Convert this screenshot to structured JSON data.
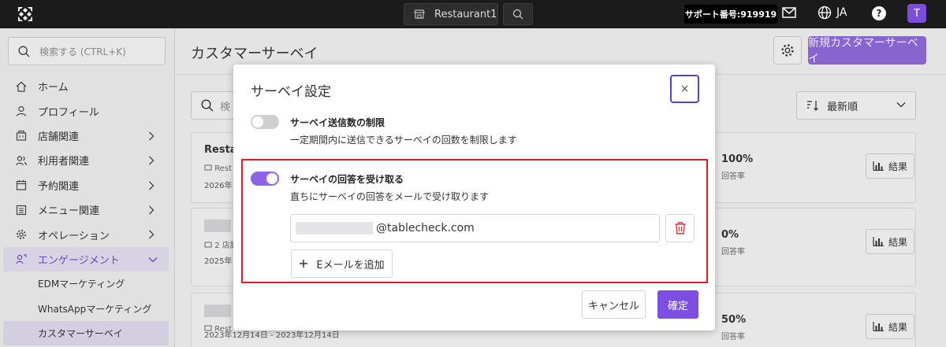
{
  "topbar": {
    "restaurant": "Restaurant1",
    "support_label": "サポート番号:",
    "support_number": "919919",
    "language": "JA",
    "help": "?",
    "avatar": "T"
  },
  "sidebar": {
    "search_placeholder": "検索する (CTRL+K)",
    "items": [
      {
        "label": "ホーム",
        "icon": "home-icon"
      },
      {
        "label": "プロフィール",
        "icon": "user-icon"
      },
      {
        "label": "店舗関連",
        "icon": "store-icon"
      },
      {
        "label": "利用者関連",
        "icon": "users-icon"
      },
      {
        "label": "予約関連",
        "icon": "calendar-icon"
      },
      {
        "label": "メニュー関連",
        "icon": "menu-icon"
      },
      {
        "label": "オペレーション",
        "icon": "gear-icon"
      },
      {
        "label": "エンゲージメント",
        "icon": "engagement-icon"
      }
    ],
    "sub_items": [
      "EDMマーケティング",
      "WhatsAppマーケティング",
      "カスタマーサーベイ"
    ]
  },
  "main": {
    "title": "カスタマーサーベイ",
    "new_button": "新規カスタマーサーベイ",
    "search_placeholder": "検",
    "sort_label": "最新順",
    "cards": [
      {
        "name": "Resta",
        "meta": "Rest",
        "date": "2026年",
        "pct": "100%",
        "rate": "回答率",
        "result": "結果"
      },
      {
        "name": "",
        "meta": "2 店舗",
        "date": "2025年",
        "pct": "0%",
        "rate": "回答率",
        "result": "結果"
      },
      {
        "name": "",
        "meta": "Rest",
        "date": "2023年12月14日 - 2023年12月14日",
        "pct": "50%",
        "rate": "回答率",
        "result": "結果"
      }
    ]
  },
  "modal": {
    "title": "サーベイ設定",
    "close": "×",
    "limit_title": "サーベイ送信数の制限",
    "limit_desc": "一定期間内に送信できるサーベイの回数を制限します",
    "receive_title": "サーベイの回答を受け取る",
    "receive_desc": "直ちにサーベイの回答をメールで受け取ります",
    "email_domain": "@tablecheck.com",
    "add_email": "Eメールを追加",
    "cancel": "キャンセル",
    "confirm": "確定"
  },
  "colors": {
    "accent": "#7d4fe0",
    "highlight": "#e01b22",
    "topbar": "#1b1b1b"
  }
}
